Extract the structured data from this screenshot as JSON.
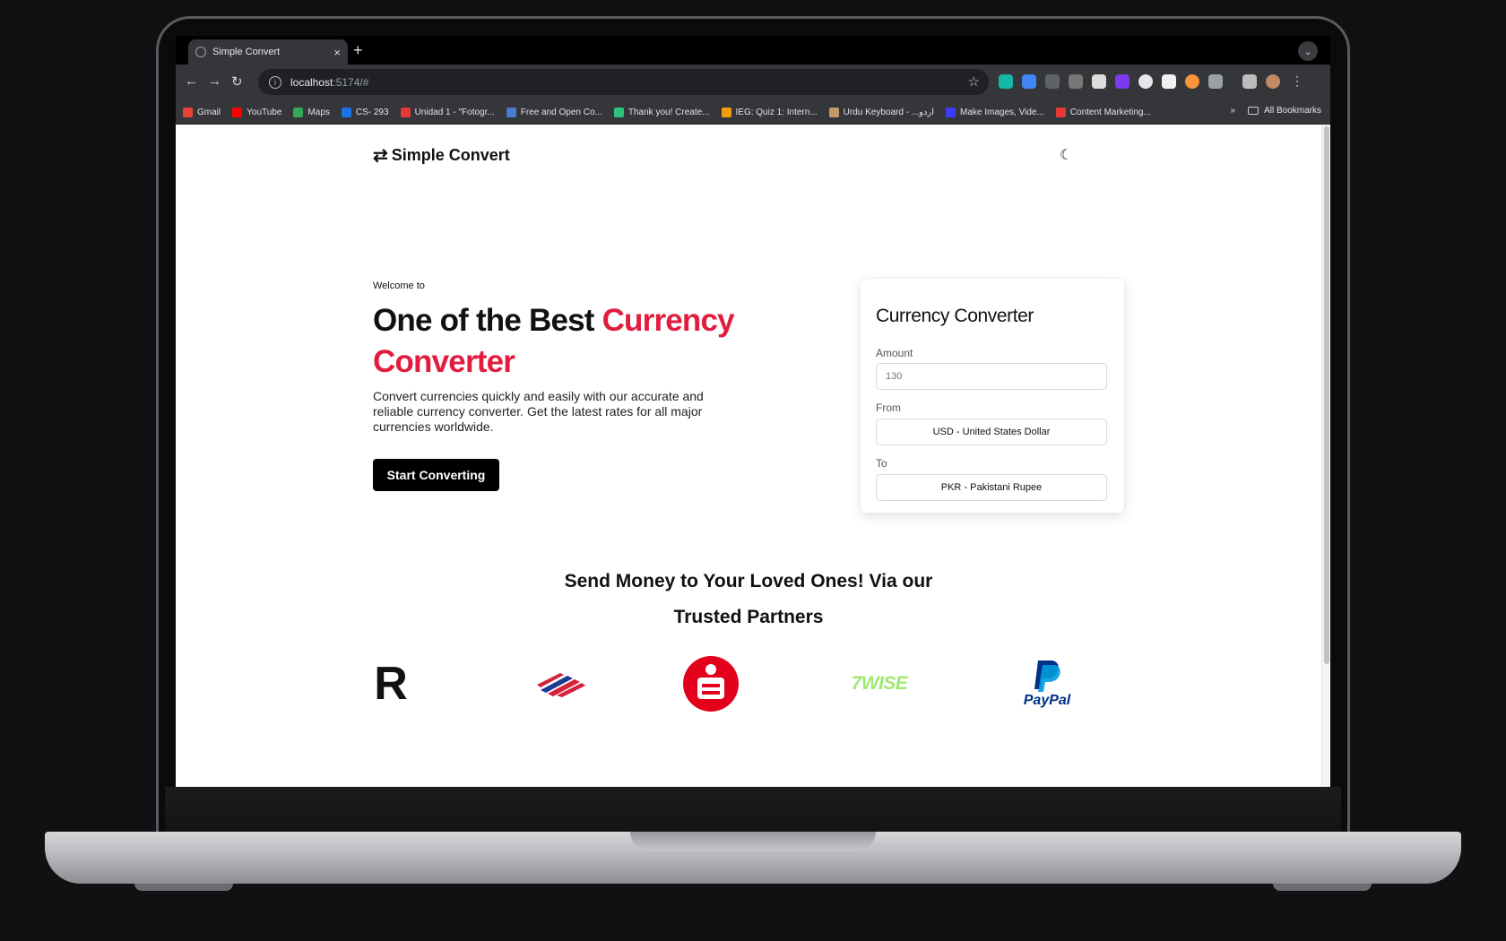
{
  "browser": {
    "tab_title": "Simple Convert",
    "tab_close": "×",
    "new_tab": "+",
    "url_host": "localhost",
    "url_path": ":5174/#",
    "bookmarks": [
      {
        "label": "Gmail",
        "color": "#ea4335"
      },
      {
        "label": "YouTube",
        "color": "#ff0000"
      },
      {
        "label": "Maps",
        "color": "#34a853"
      },
      {
        "label": "CS- 293",
        "color": "#1a73e8"
      },
      {
        "label": "Unidad 1 - \"Fotogr...",
        "color": "#e53935"
      },
      {
        "label": "Free and Open Co...",
        "color": "#4a7bd0"
      },
      {
        "label": "Thank you! Create...",
        "color": "#2ec27e"
      },
      {
        "label": "IEG: Quiz 1: Intern...",
        "color": "#f59e0b"
      },
      {
        "label": "Urdu Keyboard - ...اردو",
        "color": "#c49a6c"
      },
      {
        "label": "Make Images, Vide...",
        "color": "#3b3bff"
      },
      {
        "label": "Content Marketing...",
        "color": "#e53935"
      }
    ],
    "bookmarks_overflow": "»",
    "all_bookmarks": "All Bookmarks"
  },
  "header": {
    "brand": "Simple Convert",
    "brand_icon": "swap-arrows-icon",
    "theme_icon": "moon-icon"
  },
  "hero": {
    "welcome": "Welcome to",
    "title_plain": "One of the Best ",
    "title_accent": "Currency Converter",
    "description": "Convert currencies quickly and easily with our accurate and reliable currency converter. Get the latest rates for all major currencies worldwide.",
    "cta": "Start Converting",
    "accent_color": "#e11d3f"
  },
  "converter": {
    "title": "Currency Converter",
    "amount_label": "Amount",
    "amount_placeholder": "130",
    "from_label": "From",
    "from_value": "USD - United States Dollar",
    "to_label": "To",
    "to_value": "PKR - Pakistani Rupee"
  },
  "partners": {
    "title_line1": "Send Money to Your Loved Ones! Via our",
    "title_line2": "Trusted Partners",
    "logos": [
      {
        "name": "revolut-logo",
        "text": "R"
      },
      {
        "name": "bank-of-america-logo"
      },
      {
        "name": "sparkasse-logo"
      },
      {
        "name": "wise-logo",
        "text": "7WISE"
      },
      {
        "name": "paypal-logo",
        "text": "PayPal"
      }
    ]
  }
}
